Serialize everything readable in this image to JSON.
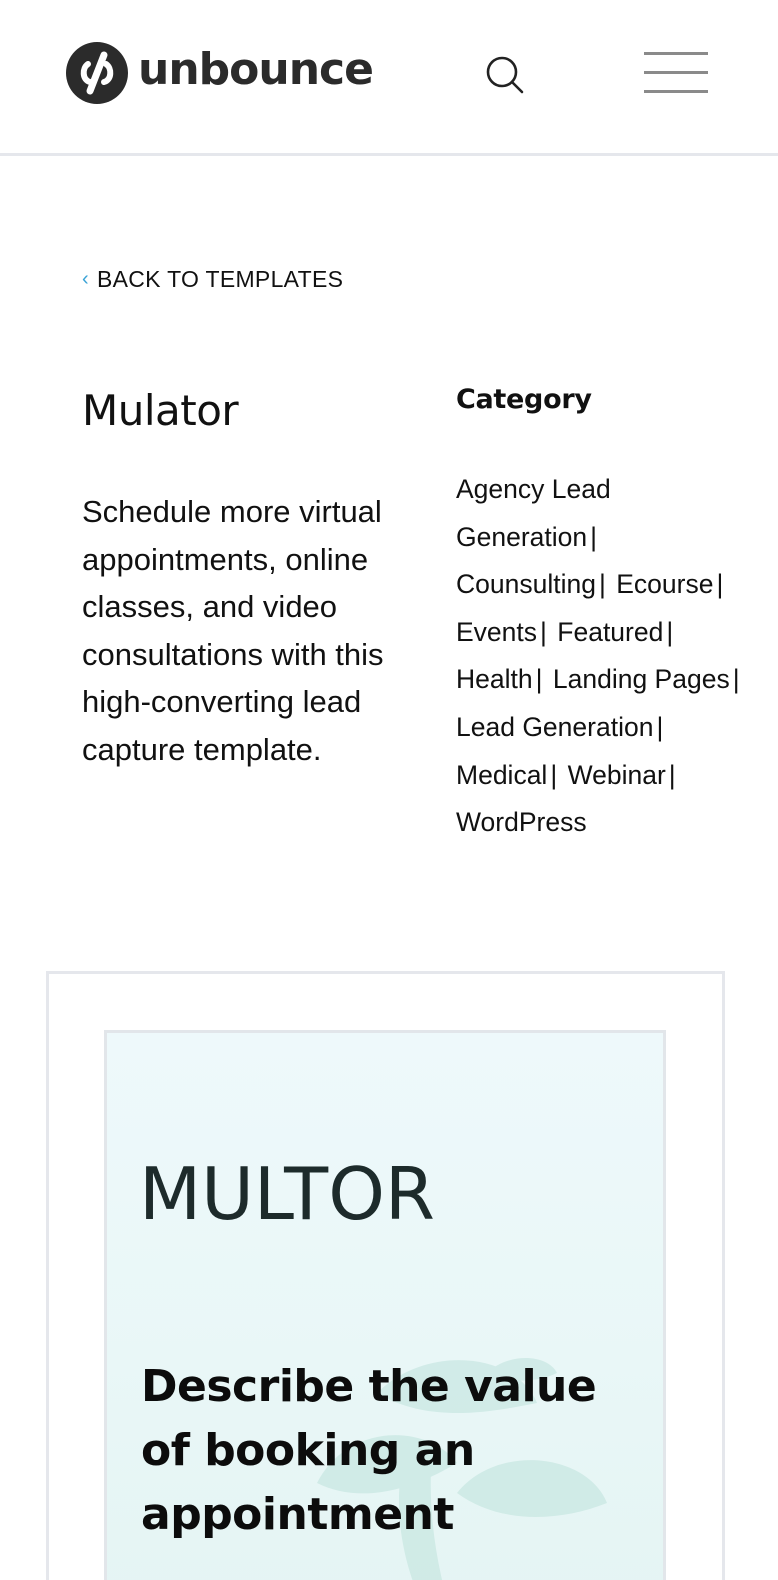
{
  "header": {
    "logo_text": "unbounce",
    "search_icon": "search-icon",
    "menu_icon": "hamburger-menu-icon"
  },
  "back_link": {
    "label": "BACK TO TEMPLATES",
    "icon": "chevron-left-icon",
    "icon_color": "#3aa3d6"
  },
  "template": {
    "title": "Mulator",
    "description": "Schedule more virtual appointments, online classes, and video consultations with this high-converting lead capture template."
  },
  "category": {
    "heading": "Category",
    "items": [
      "Agency Lead Generation",
      "Counsulting",
      "Ecourse",
      "Events",
      "Featured",
      "Health",
      "Landing Pages",
      "Lead Generation",
      "Medical",
      "Webinar",
      "WordPress"
    ],
    "separator": "|"
  },
  "preview": {
    "brand_logo": "MULTOR",
    "headline": "Describe the value of booking an appointment",
    "brand_color": "#1d2b2b"
  }
}
